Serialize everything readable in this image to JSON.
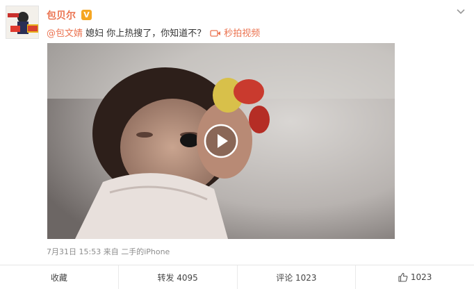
{
  "post": {
    "author": "包贝尔",
    "verified_badge": "V",
    "mention": "@包文婧",
    "text": " 媳妇 你上热搜了，你知道不？",
    "video_link": "秒拍视频",
    "timestamp": "7月31日 15:53",
    "source": "来自 二手的iPhone"
  },
  "actions": {
    "favorite": "收藏",
    "repost": "转发 4095",
    "comment": "评论 1023",
    "like": "1023"
  },
  "colors": {
    "accent": "#eb7350",
    "badge": "#f5a623"
  },
  "icons": {
    "dropdown": "chevron-down-icon",
    "video": "video-camera-icon",
    "play": "play-icon",
    "like": "thumbs-up-icon"
  }
}
